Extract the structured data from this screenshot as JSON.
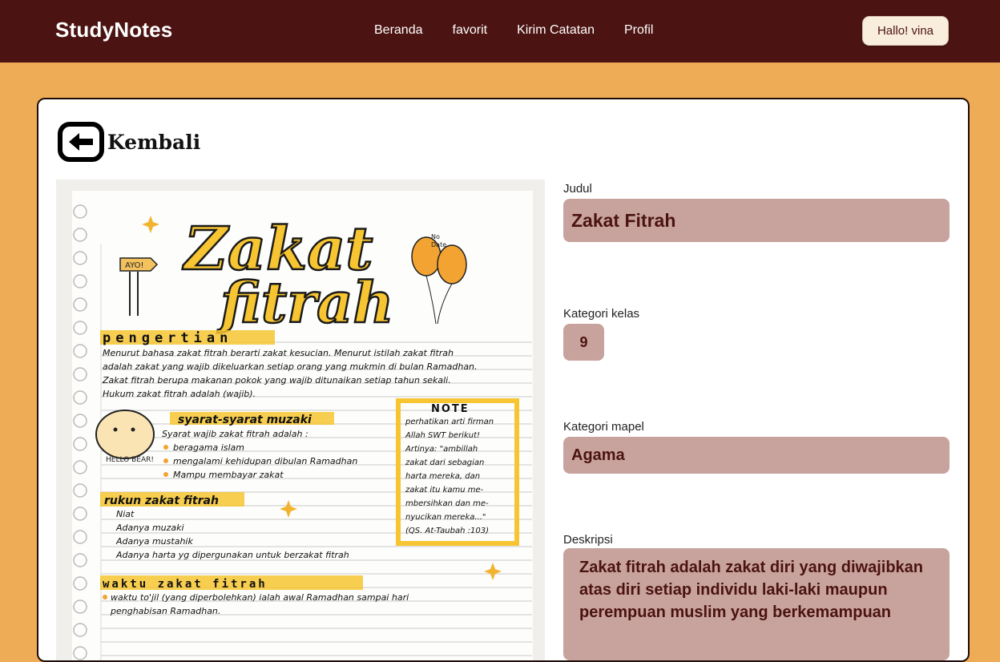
{
  "nav": {
    "brand": "StudyNotes",
    "menu": [
      "Beranda",
      "favorit",
      "Kirim Catatan",
      "Profil"
    ],
    "greeting": "Hallo! vina"
  },
  "back": {
    "label": "Kembali"
  },
  "note": {
    "title_line1": "Zakat",
    "title_line2": "fitrah",
    "sign": "AYO!",
    "meta": [
      "No",
      "Date"
    ],
    "pengertian_heading": "pengertian",
    "pengertian": [
      "Menurut bahasa zakat fitrah berarti zakat kesucian. Menurut istilah zakat fitrah",
      "adalah zakat yang wajib dikeluarkan setiap orang yang mukmin di bulan Ramadhan.",
      "Zakat fitrah berupa makanan pokok yang wajib ditunaikan setiap tahun sekali.",
      "Hukum zakat fitrah adalah (wajib)."
    ],
    "syarat_heading": "syarat-syarat muzaki",
    "syarat": [
      "Syarat wajib zakat fitrah adalah :",
      "beragama islam",
      "mengalami kehidupan dibulan Ramadhan",
      "Mampu membayar zakat"
    ],
    "bear_text": "HELLO BEAR!",
    "note_heading": "NOTE",
    "note_lines": [
      "perhatikan arti firman",
      "Allah SWT berikut!",
      "Artinya: \"ambillah",
      "zakat dari sebagian",
      "harta mereka, dan",
      "zakat itu kamu me-",
      "mbersihkan dan me-",
      "nyucikan mereka...\"",
      "(QS. At-Taubah :103)"
    ],
    "rukun_heading": "rukun zakat fitrah",
    "rukun": [
      "Niat",
      "Adanya muzaki",
      "Adanya mustahik",
      "Adanya harta yg dipergunakan untuk berzakat fitrah"
    ],
    "waktu_heading": "waktu zakat fitrah",
    "waktu": [
      "waktu to'jil (yang diperbolehkan) ialah awal Ramadhan sampai hari",
      "penghabisan Ramadhan."
    ]
  },
  "fields": {
    "judul_label": "Judul",
    "judul_value": "Zakat Fitrah",
    "kelas_label": "Kategori kelas",
    "kelas_value": "9",
    "mapel_label": "Kategori mapel",
    "mapel_value": "Agama",
    "deskripsi_label": "Deskripsi",
    "deskripsi_value": "Zakat fitrah adalah zakat diri yang diwajibkan atas diri setiap individu laki-laki maupun perempuan muslim yang berkemampuan"
  }
}
